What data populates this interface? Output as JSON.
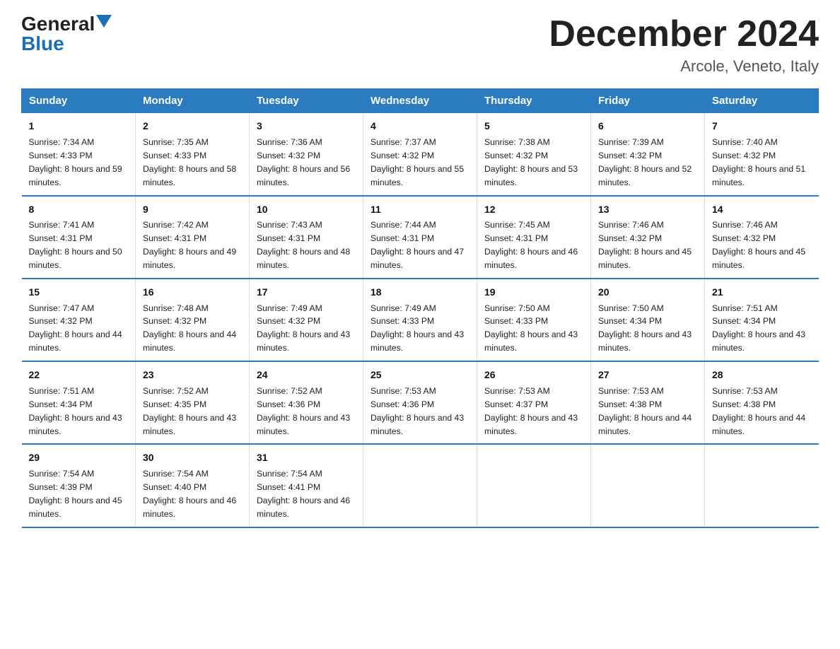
{
  "logo": {
    "general": "General",
    "blue": "Blue"
  },
  "title": "December 2024",
  "location": "Arcole, Veneto, Italy",
  "days_of_week": [
    "Sunday",
    "Monday",
    "Tuesday",
    "Wednesday",
    "Thursday",
    "Friday",
    "Saturday"
  ],
  "weeks": [
    [
      {
        "num": "1",
        "sunrise": "7:34 AM",
        "sunset": "4:33 PM",
        "daylight": "8 hours and 59 minutes."
      },
      {
        "num": "2",
        "sunrise": "7:35 AM",
        "sunset": "4:33 PM",
        "daylight": "8 hours and 58 minutes."
      },
      {
        "num": "3",
        "sunrise": "7:36 AM",
        "sunset": "4:32 PM",
        "daylight": "8 hours and 56 minutes."
      },
      {
        "num": "4",
        "sunrise": "7:37 AM",
        "sunset": "4:32 PM",
        "daylight": "8 hours and 55 minutes."
      },
      {
        "num": "5",
        "sunrise": "7:38 AM",
        "sunset": "4:32 PM",
        "daylight": "8 hours and 53 minutes."
      },
      {
        "num": "6",
        "sunrise": "7:39 AM",
        "sunset": "4:32 PM",
        "daylight": "8 hours and 52 minutes."
      },
      {
        "num": "7",
        "sunrise": "7:40 AM",
        "sunset": "4:32 PM",
        "daylight": "8 hours and 51 minutes."
      }
    ],
    [
      {
        "num": "8",
        "sunrise": "7:41 AM",
        "sunset": "4:31 PM",
        "daylight": "8 hours and 50 minutes."
      },
      {
        "num": "9",
        "sunrise": "7:42 AM",
        "sunset": "4:31 PM",
        "daylight": "8 hours and 49 minutes."
      },
      {
        "num": "10",
        "sunrise": "7:43 AM",
        "sunset": "4:31 PM",
        "daylight": "8 hours and 48 minutes."
      },
      {
        "num": "11",
        "sunrise": "7:44 AM",
        "sunset": "4:31 PM",
        "daylight": "8 hours and 47 minutes."
      },
      {
        "num": "12",
        "sunrise": "7:45 AM",
        "sunset": "4:31 PM",
        "daylight": "8 hours and 46 minutes."
      },
      {
        "num": "13",
        "sunrise": "7:46 AM",
        "sunset": "4:32 PM",
        "daylight": "8 hours and 45 minutes."
      },
      {
        "num": "14",
        "sunrise": "7:46 AM",
        "sunset": "4:32 PM",
        "daylight": "8 hours and 45 minutes."
      }
    ],
    [
      {
        "num": "15",
        "sunrise": "7:47 AM",
        "sunset": "4:32 PM",
        "daylight": "8 hours and 44 minutes."
      },
      {
        "num": "16",
        "sunrise": "7:48 AM",
        "sunset": "4:32 PM",
        "daylight": "8 hours and 44 minutes."
      },
      {
        "num": "17",
        "sunrise": "7:49 AM",
        "sunset": "4:32 PM",
        "daylight": "8 hours and 43 minutes."
      },
      {
        "num": "18",
        "sunrise": "7:49 AM",
        "sunset": "4:33 PM",
        "daylight": "8 hours and 43 minutes."
      },
      {
        "num": "19",
        "sunrise": "7:50 AM",
        "sunset": "4:33 PM",
        "daylight": "8 hours and 43 minutes."
      },
      {
        "num": "20",
        "sunrise": "7:50 AM",
        "sunset": "4:34 PM",
        "daylight": "8 hours and 43 minutes."
      },
      {
        "num": "21",
        "sunrise": "7:51 AM",
        "sunset": "4:34 PM",
        "daylight": "8 hours and 43 minutes."
      }
    ],
    [
      {
        "num": "22",
        "sunrise": "7:51 AM",
        "sunset": "4:34 PM",
        "daylight": "8 hours and 43 minutes."
      },
      {
        "num": "23",
        "sunrise": "7:52 AM",
        "sunset": "4:35 PM",
        "daylight": "8 hours and 43 minutes."
      },
      {
        "num": "24",
        "sunrise": "7:52 AM",
        "sunset": "4:36 PM",
        "daylight": "8 hours and 43 minutes."
      },
      {
        "num": "25",
        "sunrise": "7:53 AM",
        "sunset": "4:36 PM",
        "daylight": "8 hours and 43 minutes."
      },
      {
        "num": "26",
        "sunrise": "7:53 AM",
        "sunset": "4:37 PM",
        "daylight": "8 hours and 43 minutes."
      },
      {
        "num": "27",
        "sunrise": "7:53 AM",
        "sunset": "4:38 PM",
        "daylight": "8 hours and 44 minutes."
      },
      {
        "num": "28",
        "sunrise": "7:53 AM",
        "sunset": "4:38 PM",
        "daylight": "8 hours and 44 minutes."
      }
    ],
    [
      {
        "num": "29",
        "sunrise": "7:54 AM",
        "sunset": "4:39 PM",
        "daylight": "8 hours and 45 minutes."
      },
      {
        "num": "30",
        "sunrise": "7:54 AM",
        "sunset": "4:40 PM",
        "daylight": "8 hours and 46 minutes."
      },
      {
        "num": "31",
        "sunrise": "7:54 AM",
        "sunset": "4:41 PM",
        "daylight": "8 hours and 46 minutes."
      },
      null,
      null,
      null,
      null
    ]
  ]
}
